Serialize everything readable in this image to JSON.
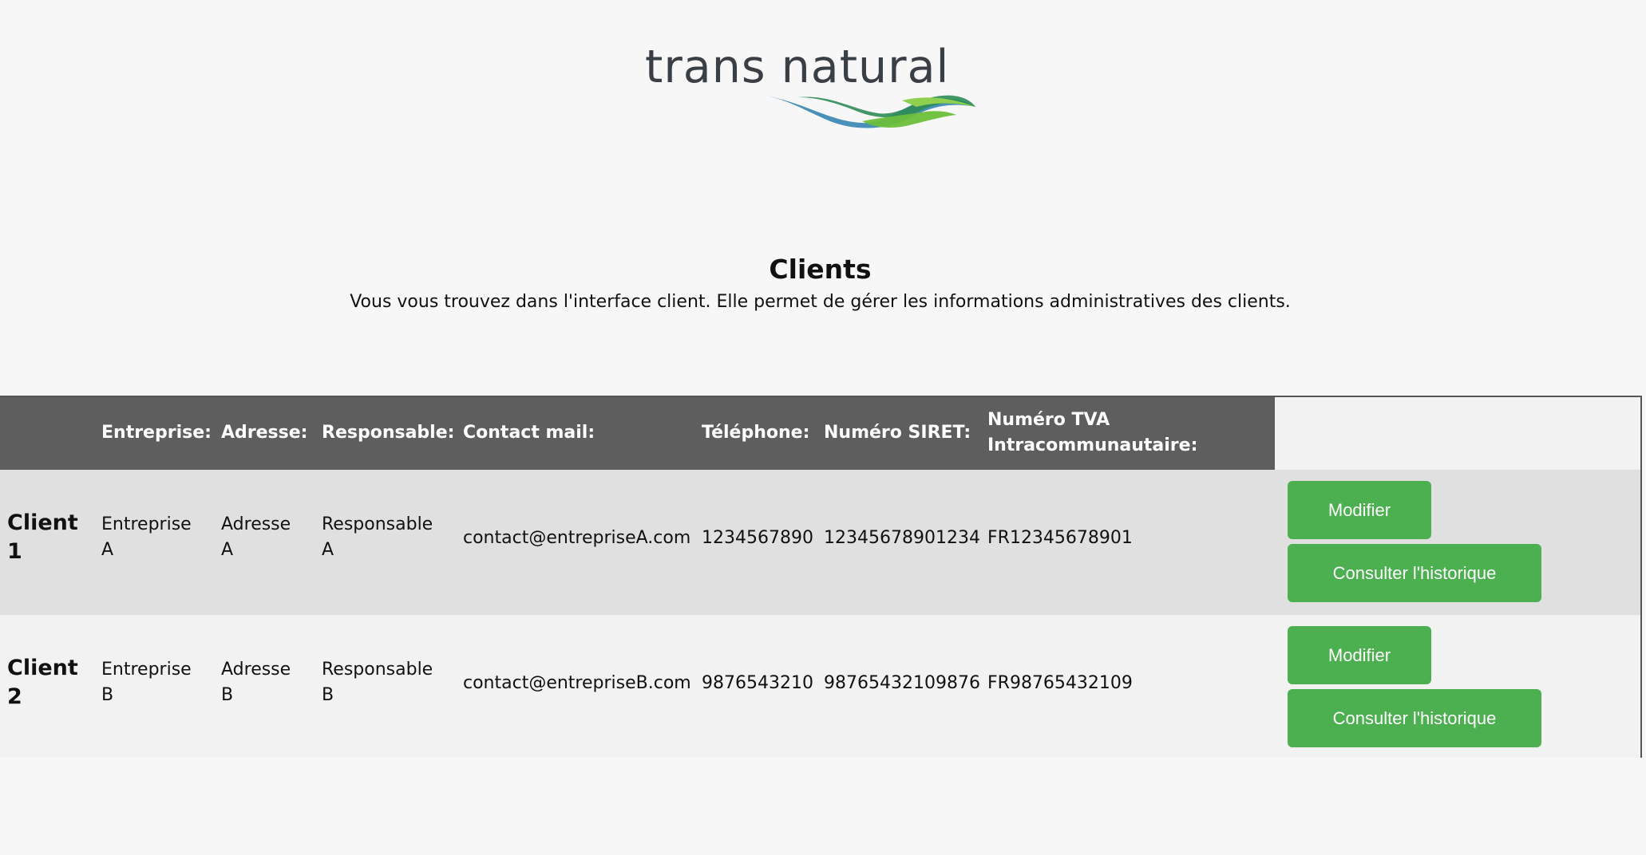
{
  "logo": {
    "text": "trans natural",
    "wave_colors": [
      "#1f8fbf",
      "#2e8b57",
      "#6cbf3a"
    ]
  },
  "page": {
    "title": "Clients",
    "subtitle": "Vous vous trouvez dans l'interface client. Elle permet de gérer les informations administratives des clients."
  },
  "table": {
    "headers": {
      "entreprise": "Entreprise:",
      "adresse": "Adresse:",
      "responsable": "Responsable:",
      "contact": "Contact mail:",
      "telephone": "Téléphone:",
      "siret": "Numéro SIRET:",
      "tva": "Numéro TVA\nIntracommunautaire:"
    },
    "rows": [
      {
        "label": "Client\n1",
        "entreprise": "Entreprise\nA",
        "adresse": "Adresse\nA",
        "responsable": "Responsable\nA",
        "contact": "contact@entrepriseA.com",
        "telephone": "1234567890",
        "siret": "12345678901234",
        "tva": "FR12345678901",
        "modify_label": "Modifier",
        "history_label": "Consulter l'historique"
      },
      {
        "label": "Client\n2",
        "entreprise": "Entreprise\nB",
        "adresse": "Adresse\nB",
        "responsable": "Responsable\nB",
        "contact": "contact@entrepriseB.com",
        "telephone": "9876543210",
        "siret": "98765432109876",
        "tva": "FR98765432109",
        "modify_label": "Modifier",
        "history_label": "Consulter l'historique"
      }
    ]
  },
  "colors": {
    "header_bg": "#5e5e5e",
    "button_green": "#4caf50",
    "row_odd": "#e0e0e0",
    "row_even": "#f2f2f2"
  }
}
